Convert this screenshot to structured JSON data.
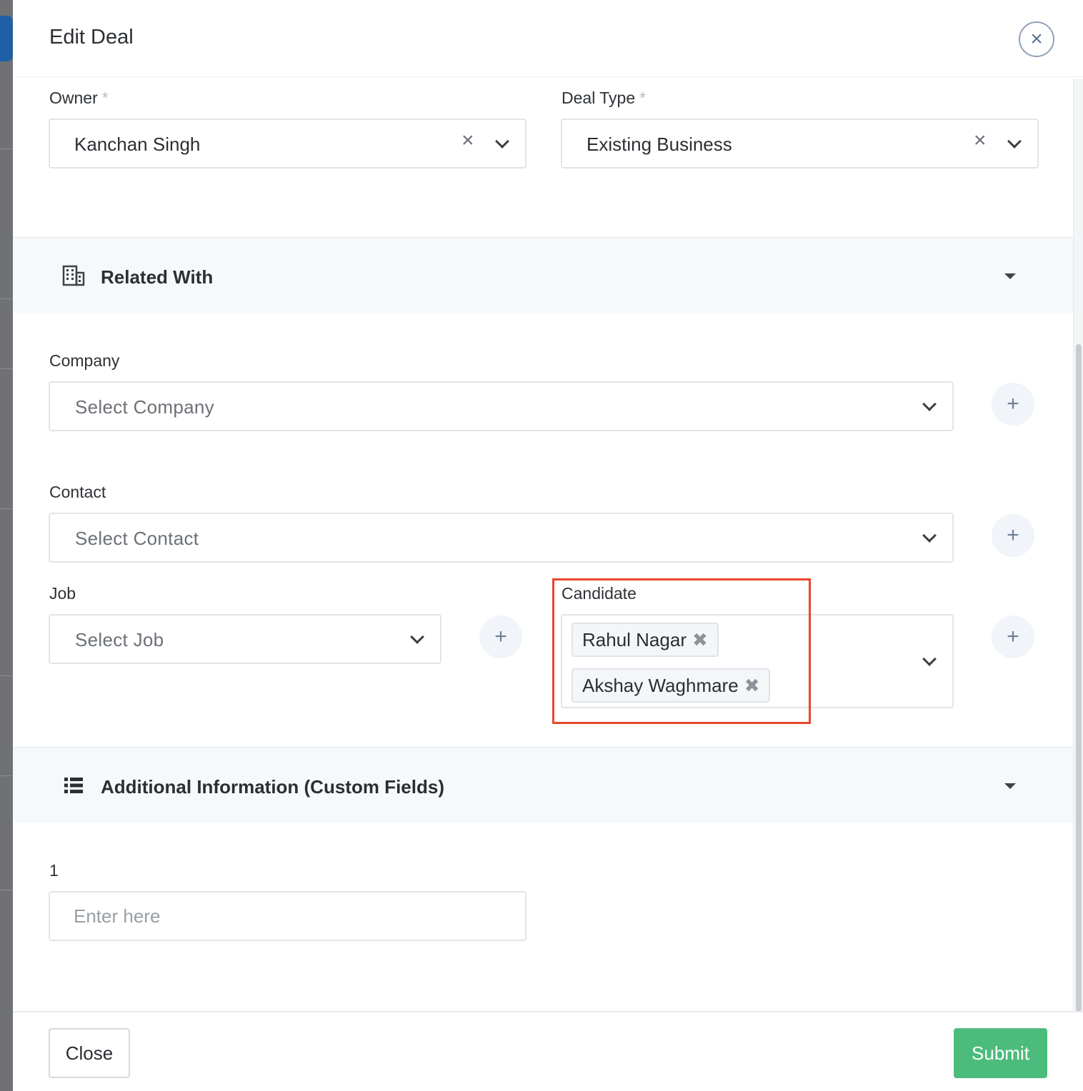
{
  "modal": {
    "title": "Edit Deal"
  },
  "owner": {
    "label": "Owner",
    "required_mark": "*",
    "value": "Kanchan Singh"
  },
  "deal_type": {
    "label": "Deal Type",
    "required_mark": "*",
    "value": "Existing Business"
  },
  "related_with": {
    "title": "Related With",
    "icon": "building-icon"
  },
  "company": {
    "label": "Company",
    "placeholder": "Select Company"
  },
  "contact": {
    "label": "Contact",
    "placeholder": "Select Contact"
  },
  "job": {
    "label": "Job",
    "placeholder": "Select Job"
  },
  "candidate": {
    "label": "Candidate",
    "tags": [
      "Rahul Nagar",
      "Akshay Waghmare"
    ]
  },
  "additional_info": {
    "title": "Additional Information (Custom Fields)",
    "icon": "list-icon"
  },
  "custom_field": {
    "label": "1",
    "placeholder": "Enter here"
  },
  "footer": {
    "close_label": "Close",
    "submit_label": "Submit"
  },
  "colors": {
    "submit": "#4cbc7c",
    "highlight": "#e8482b",
    "section_bg": "#f6f9fc"
  }
}
